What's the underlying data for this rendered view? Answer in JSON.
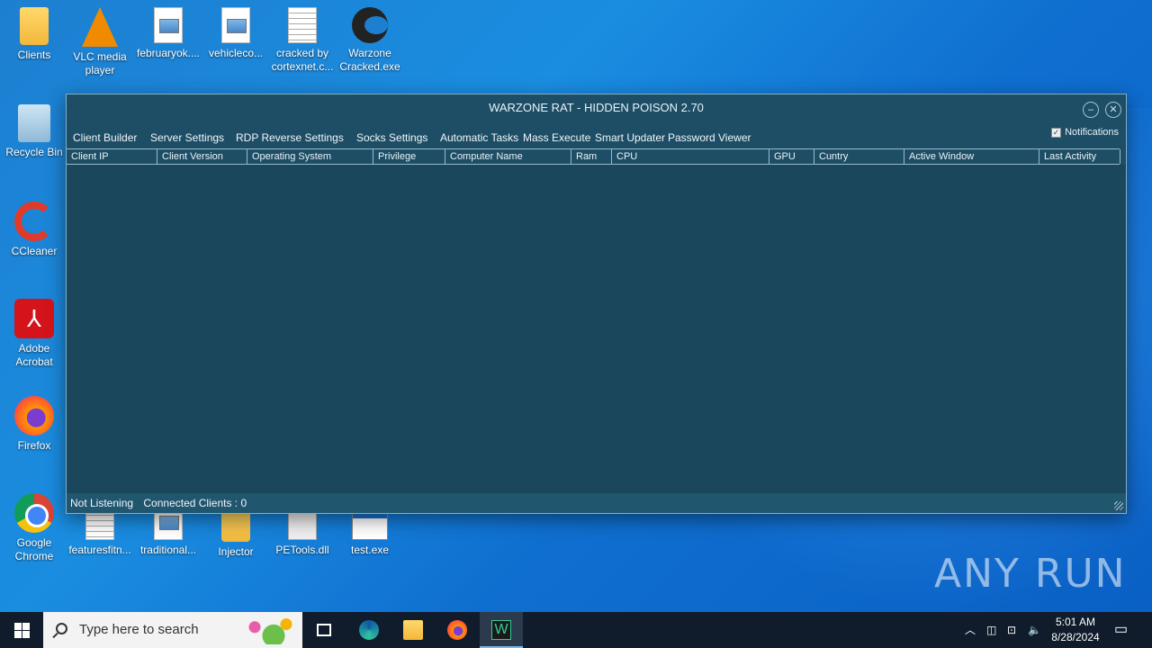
{
  "desktop": {
    "icons": [
      {
        "label": "Clients"
      },
      {
        "label": "VLC media player"
      },
      {
        "label": "februaryok...."
      },
      {
        "label": "vehicleco..."
      },
      {
        "label": "cracked by cortexnet.c..."
      },
      {
        "label": "Warzone Cracked.exe"
      },
      {
        "label": "Recycle Bin"
      },
      {
        "label": "CCleaner"
      },
      {
        "label": "Adobe Acrobat"
      },
      {
        "label": "Firefox"
      },
      {
        "label": "Google Chrome"
      },
      {
        "label": "featuresfitn..."
      },
      {
        "label": "traditional..."
      },
      {
        "label": "Injector"
      },
      {
        "label": "PETools.dll"
      },
      {
        "label": "test.exe"
      }
    ]
  },
  "window": {
    "title": "WARZONE RAT - HIDDEN POISON 2.70",
    "menu": [
      "Client Builder",
      "Server Settings",
      "RDP Reverse Settings",
      "Socks Settings",
      "Automatic Tasks",
      "Mass Execute",
      "Smart Updater",
      "Password Viewer"
    ],
    "notifications_label": "Notifications",
    "notifications_checked": true,
    "columns": [
      "Client IP",
      "Client Version",
      "Operating System",
      "Privilege",
      "Computer Name",
      "Ram",
      "CPU",
      "GPU",
      "Cuntry",
      "Active Window",
      "Last Activity"
    ],
    "status": {
      "listening": "Not Listening",
      "clients": "Connected Clients : 0"
    }
  },
  "watermark": "ANY RUN",
  "taskbar": {
    "search_placeholder": "Type here to search",
    "time": "5:01 AM",
    "date": "8/28/2024"
  },
  "colors": {
    "window_bg": "#1e4e66",
    "taskbar_bg": "#101c2b",
    "desktop_bg": "#1a8de0"
  }
}
